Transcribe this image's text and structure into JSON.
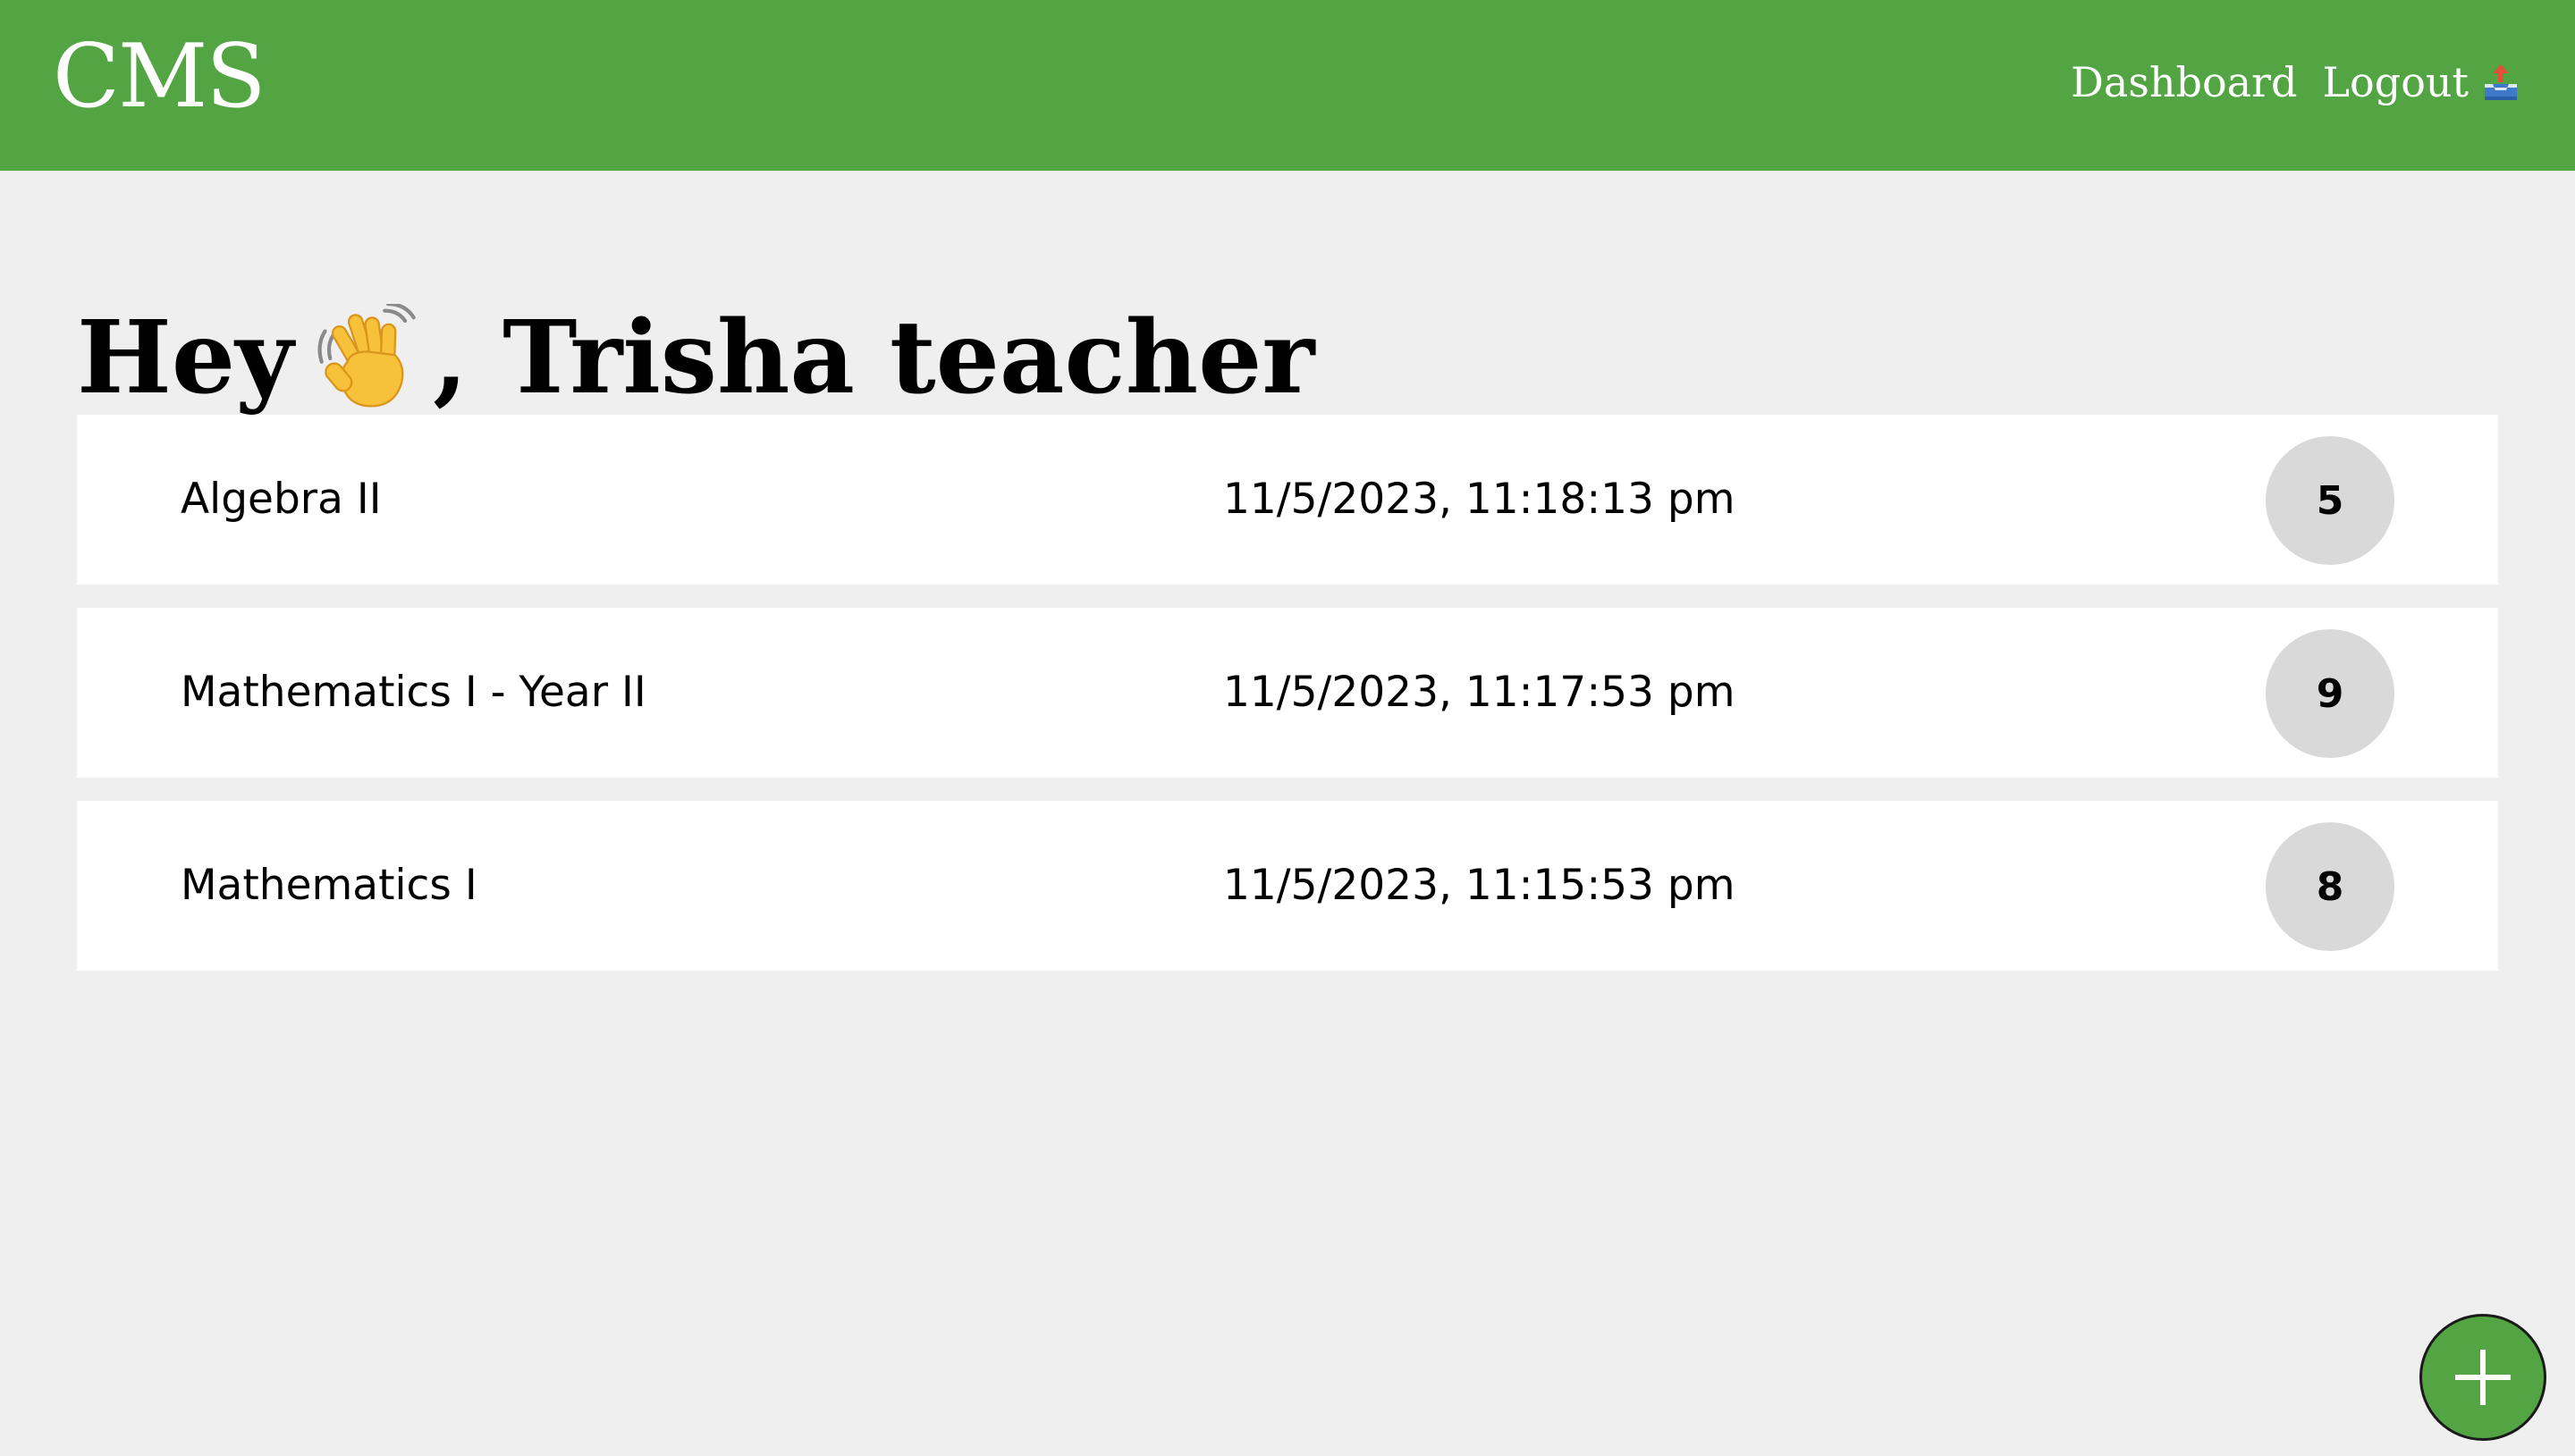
{
  "header": {
    "brand": "CMS",
    "nav": {
      "dashboard_label": "Dashboard",
      "logout_label": "Logout",
      "logout_icon": "outbox-tray-icon"
    }
  },
  "greeting": {
    "prefix": "Hey",
    "icon": "waving-hand-icon",
    "suffix": ", Trisha teacher"
  },
  "courses": [
    {
      "name": "Algebra II",
      "updated": "11/5/2023, 11:18:13 pm",
      "count": "5"
    },
    {
      "name": "Mathematics I - Year II",
      "updated": "11/5/2023, 11:17:53 pm",
      "count": "9"
    },
    {
      "name": "Mathematics I",
      "updated": "11/5/2023, 11:15:53 pm",
      "count": "8"
    }
  ],
  "fab": {
    "icon": "plus-icon"
  },
  "colors": {
    "brand_green": "#53a443",
    "page_background": "#efefef",
    "row_background": "#ffffff",
    "badge_background": "#d9d9d9"
  }
}
